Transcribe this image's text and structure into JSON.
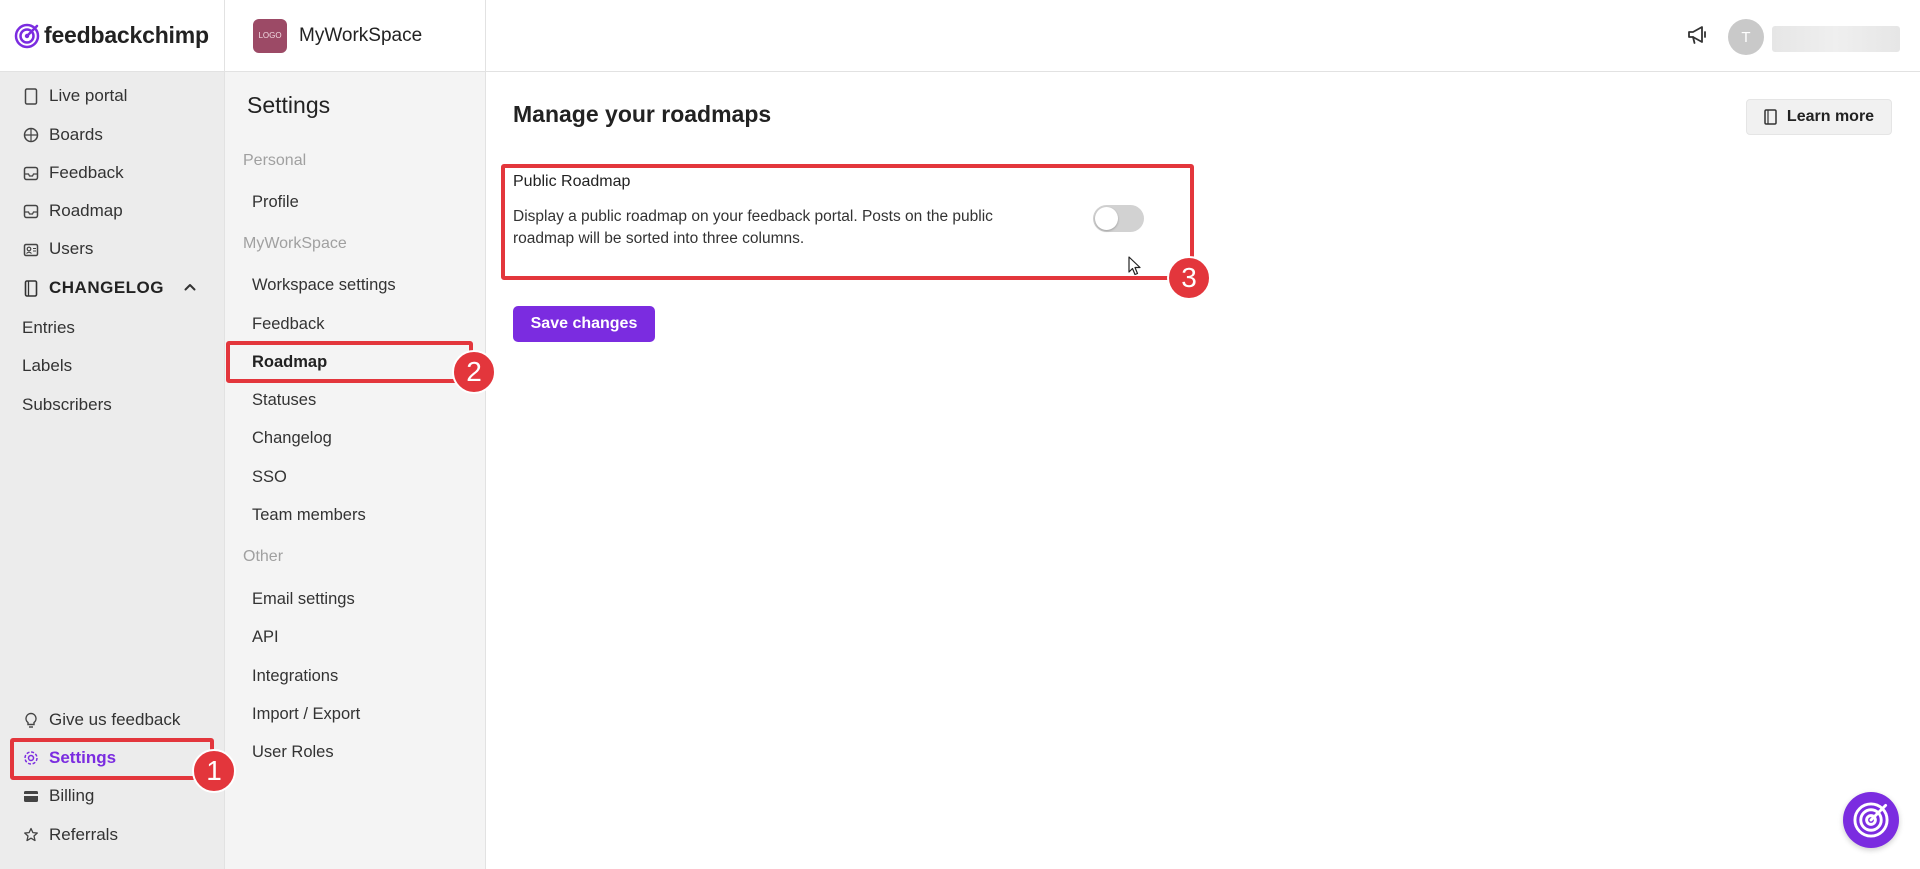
{
  "brand": {
    "name": "feedbackchimp"
  },
  "nav": {
    "items": [
      {
        "label": "Live portal",
        "icon": "tablet-icon"
      },
      {
        "label": "Boards",
        "icon": "boards-icon"
      },
      {
        "label": "Feedback",
        "icon": "inbox-icon"
      },
      {
        "label": "Roadmap",
        "icon": "roadmap-icon"
      },
      {
        "label": "Users",
        "icon": "users-icon"
      }
    ],
    "changelog": {
      "label": "CHANGELOG",
      "items": [
        "Entries",
        "Labels",
        "Subscribers"
      ]
    },
    "bottom": [
      {
        "label": "Give us feedback",
        "icon": "lightbulb-icon"
      },
      {
        "label": "Settings",
        "icon": "gear-icon"
      },
      {
        "label": "Billing",
        "icon": "credit-card-icon"
      },
      {
        "label": "Referrals",
        "icon": "star-icon"
      }
    ]
  },
  "workspace": {
    "name": "MyWorkSpace",
    "logo_text": "LOGO"
  },
  "settings": {
    "title": "Settings",
    "groups": [
      {
        "label": "Personal",
        "items": [
          "Profile"
        ]
      },
      {
        "label": "MyWorkSpace",
        "items": [
          "Workspace settings",
          "Feedback",
          "Roadmap",
          "Statuses",
          "Changelog",
          "SSO",
          "Team members"
        ]
      },
      {
        "label": "Other",
        "items": [
          "Email settings",
          "API",
          "Integrations",
          "Import / Export",
          "User Roles"
        ]
      }
    ],
    "active": "Roadmap"
  },
  "topbar": {
    "avatar_initial": "T"
  },
  "main": {
    "title": "Manage your roadmaps",
    "learn_more": "Learn more",
    "card": {
      "label": "Public Roadmap",
      "description": "Display a public roadmap on your feedback portal. Posts on the public roadmap will be sorted into three columns.",
      "enabled": false
    },
    "save_label": "Save changes"
  },
  "annotations": [
    "1",
    "2",
    "3"
  ],
  "colors": {
    "accent": "#7b2ce0",
    "annotation": "#e3363c"
  }
}
